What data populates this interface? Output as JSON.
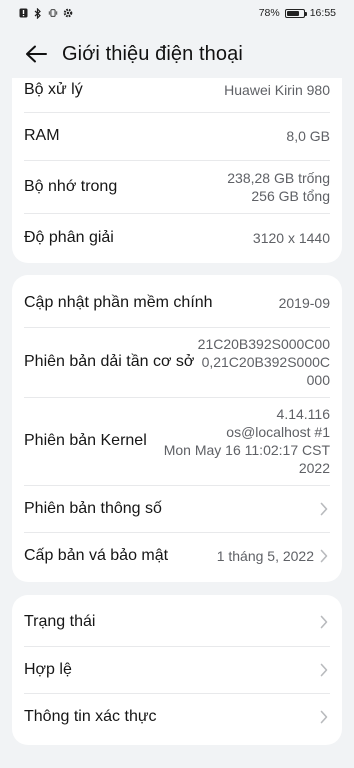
{
  "status_bar": {
    "battery_percent": "78%",
    "time": "16:55",
    "battery_level": 0.78
  },
  "header": {
    "title": "Giới thiệu điện thoại"
  },
  "card1": {
    "processor_label": "Bộ xử lý",
    "processor_value": "Huawei Kirin 980",
    "ram_label": "RAM",
    "ram_value": "8,0 GB",
    "storage_label": "Bộ nhớ trong",
    "storage_free": "238,28  GB trống",
    "storage_total": "256  GB tổng",
    "resolution_label": "Độ phân giải",
    "resolution_value": "3120 x 1440"
  },
  "card2": {
    "update_label": "Cập nhật phần mềm chính",
    "update_value": "2019-09",
    "baseband_label": "Phiên bản dải tần cơ sở",
    "baseband_line1": "21C20B392S000C00",
    "baseband_line2": "0,21C20B392S000C",
    "baseband_line3": "000",
    "kernel_label": "Phiên bản Kernel",
    "kernel_line1": "4.14.116",
    "kernel_line2": "os@localhost #1",
    "kernel_line3": "Mon May 16 11:02:17 CST",
    "kernel_line4": "2022",
    "spec_label": "Phiên bản thông số",
    "patch_label": "Cấp bản vá bảo mật",
    "patch_value": "1 tháng 5, 2022"
  },
  "card3": {
    "status_label": "Trạng thái",
    "legal_label": "Hợp lệ",
    "auth_label": "Thông tin xác thực"
  },
  "icons": {
    "back": "arrow-left-icon",
    "chevron": "chevron-right-icon"
  },
  "colors": {
    "background": "#f1f3f5",
    "card": "#ffffff",
    "value_text": "#5f6166"
  }
}
